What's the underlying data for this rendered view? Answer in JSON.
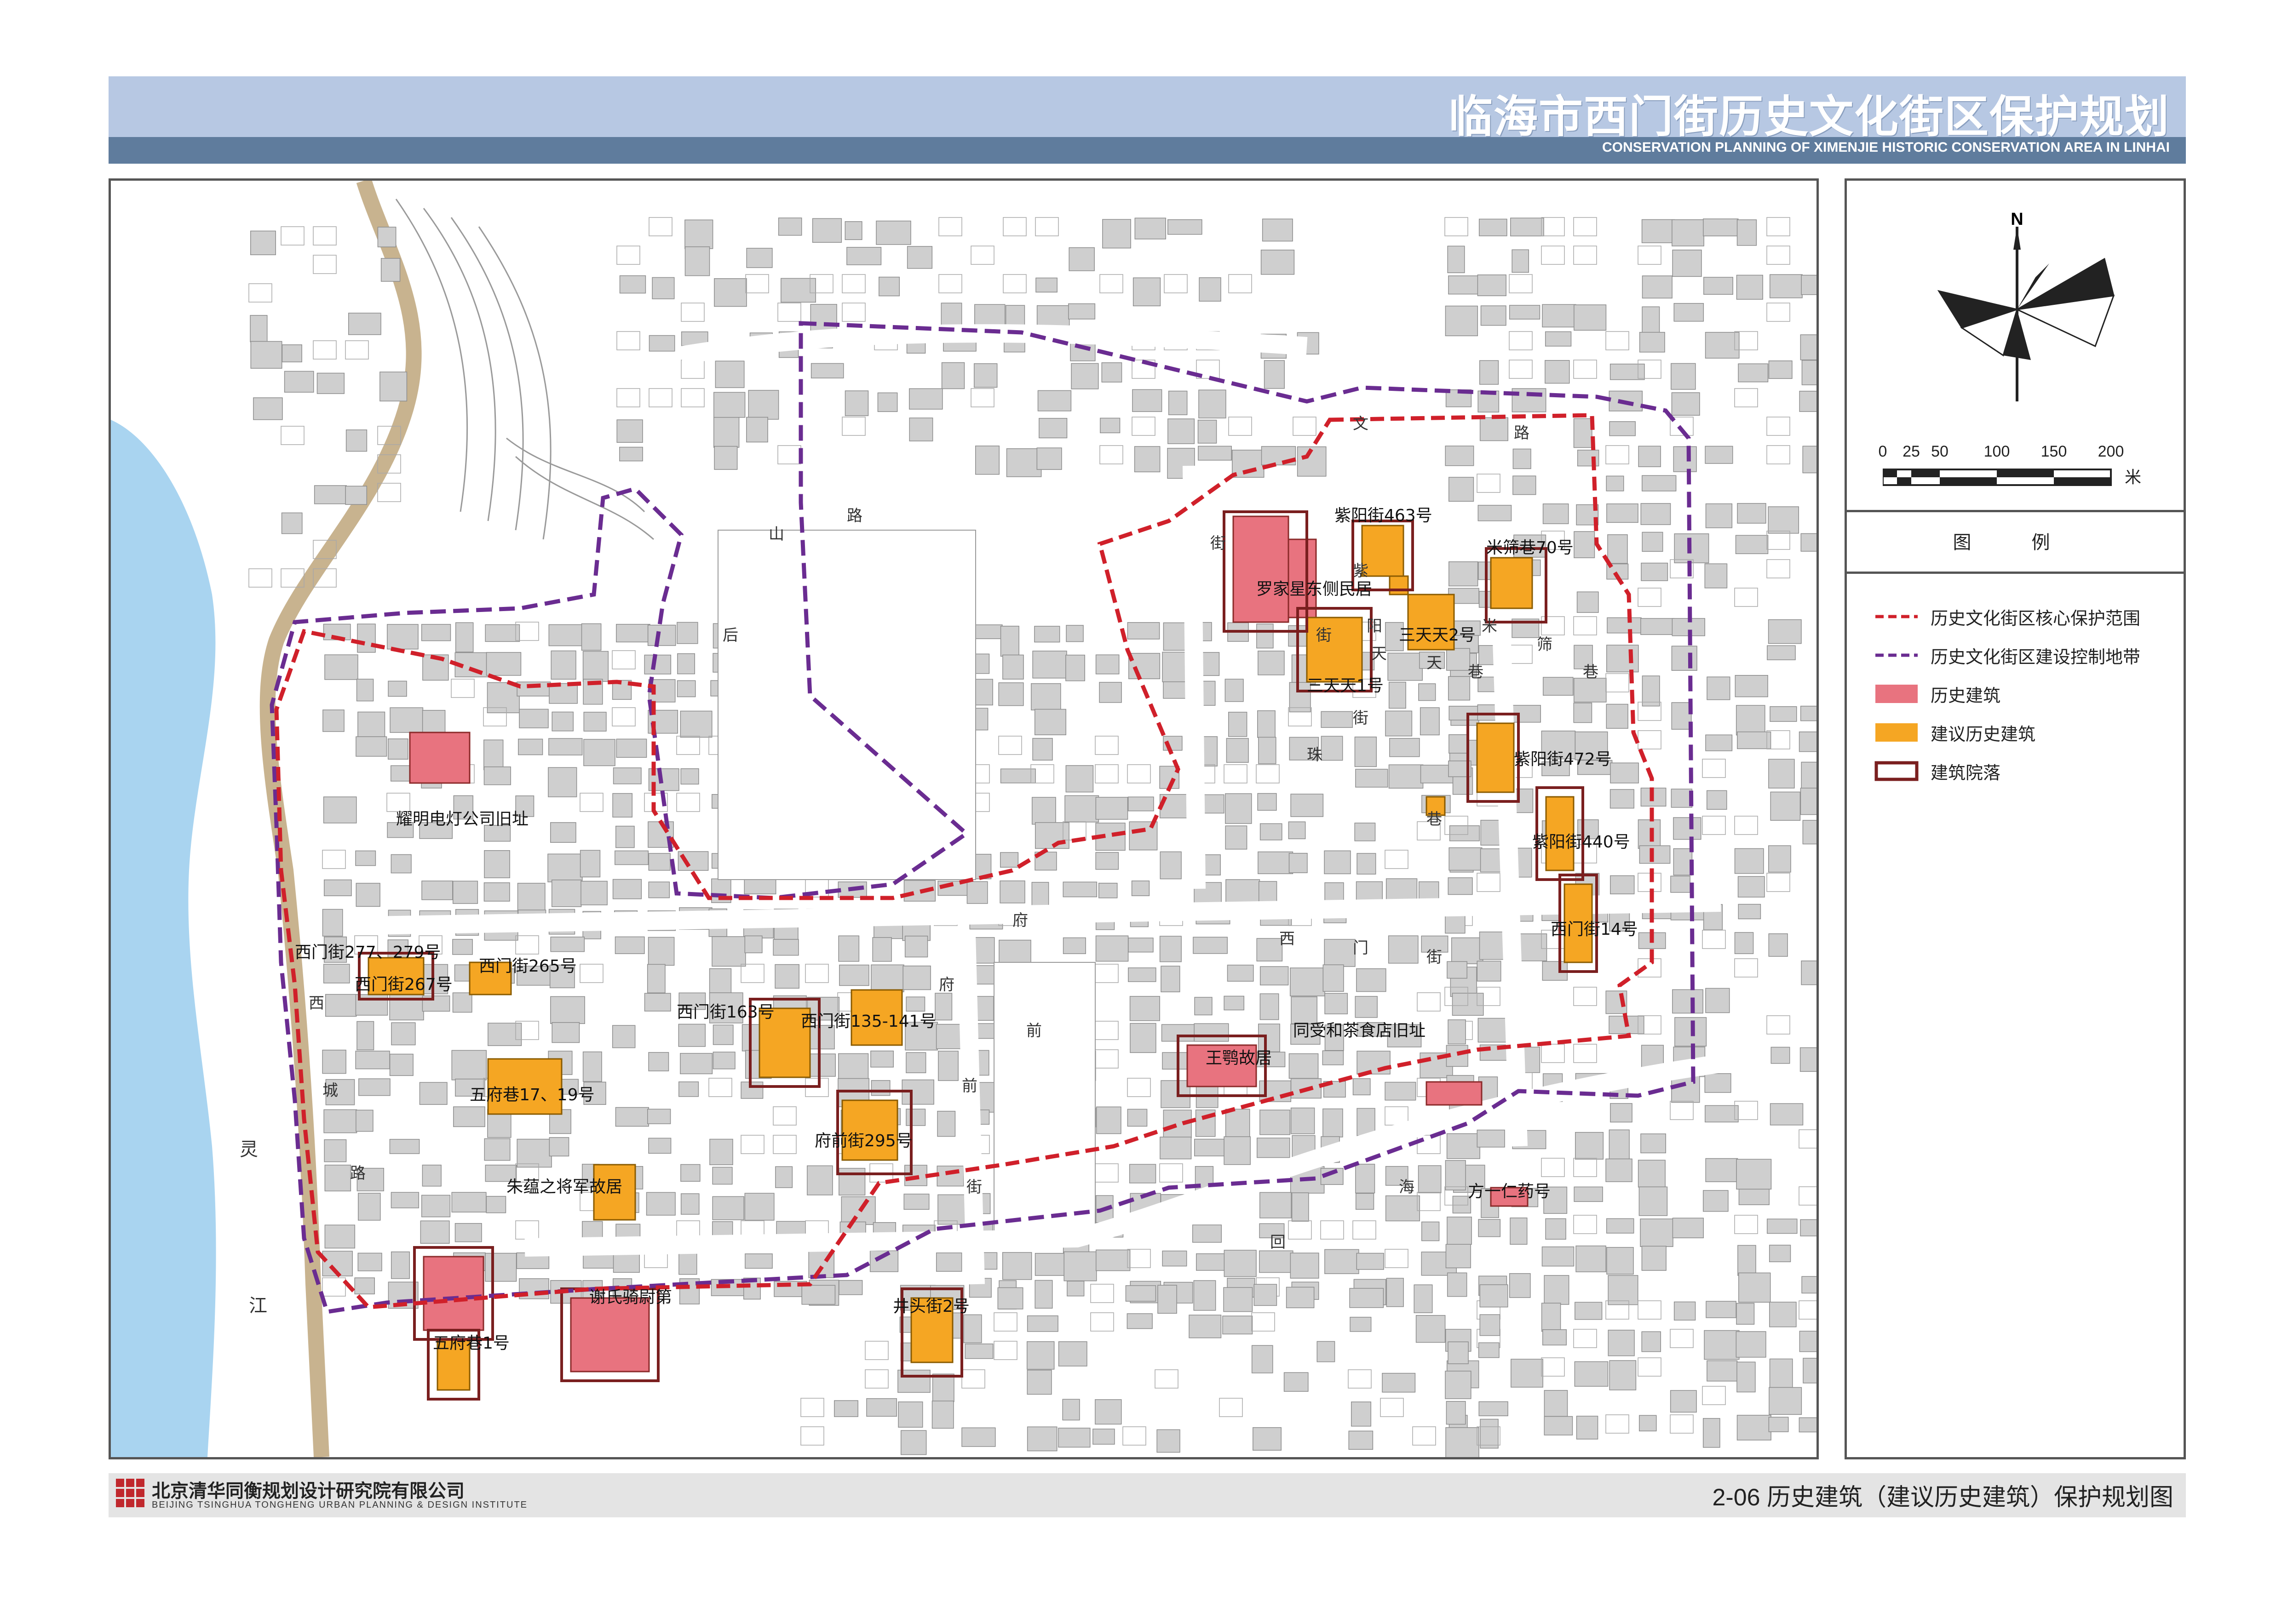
{
  "header": {
    "title_cn": "临海市西门街历史文化街区保护规划",
    "title_en": "CONSERVATION PLANNING OF XIMENJIE HISTORIC CONSERVATION AREA IN LINHAI"
  },
  "colors": {
    "header_band": "#b7c8e3",
    "header_rule": "#5f7c9d",
    "historic_building": "#e8737f",
    "proposed_historic_building": "#f5a623",
    "core_boundary": "#d0202a",
    "control_boundary": "#6a2c91",
    "courtyard": "#7a1f1f",
    "river": "#a9d4f0",
    "city_wall": "#c8b38f",
    "building_gray": "#cfcfcf"
  },
  "compass": {
    "north_label": "N"
  },
  "scale_bar": {
    "ticks": [
      "0",
      "25",
      "50",
      "100",
      "150",
      "200"
    ],
    "unit": "米"
  },
  "legend": {
    "title": "图 例",
    "items": [
      {
        "label": "历史文化街区核心保护范围",
        "swatch": "core-boundary"
      },
      {
        "label": "历史文化街区建设控制地带",
        "swatch": "control-boundary"
      },
      {
        "label": "历史建筑",
        "swatch": "historic-building"
      },
      {
        "label": "建议历史建筑",
        "swatch": "proposed-historic-building"
      },
      {
        "label": "建筑院落",
        "swatch": "courtyard"
      }
    ]
  },
  "map": {
    "labels": [
      "紫阳街463号",
      "罗家星东侧民居",
      "米筛巷70号",
      "三天天2号",
      "三天天1号",
      "紫阳街472号",
      "紫阳街440号",
      "西门街14号",
      "耀明电灯公司旧址",
      "西门街277、279号",
      "西门街265号",
      "西门街267号",
      "西门街163号",
      "西门街135-141号",
      "王鹗故居",
      "同受和茶食店旧址",
      "五府巷17、19号",
      "府前街295号",
      "方一仁药号",
      "朱蕴之将军故居",
      "谢氏骑尉第",
      "井头街2号",
      "五府巷1号"
    ],
    "road_chars": [
      "文",
      "路",
      "路",
      "山",
      "后",
      "街",
      "街",
      "街",
      "府",
      "前",
      "街",
      "西",
      "城",
      "路",
      "回",
      "海",
      "紫",
      "阳",
      "珠",
      "巷",
      "米",
      "筛",
      "巷",
      "天",
      "天",
      "巷",
      "西",
      "门",
      "街",
      "府",
      "前",
      "灵",
      "江"
    ]
  },
  "footer": {
    "org_cn": "北京清华同衡规划设计研究院有限公司",
    "org_en": "BEIJING TSINGHUA TONGHENG URBAN PLANNING & DESIGN INSTITUTE",
    "drawing_title": "2-06 历史建筑（建议历史建筑）保护规划图"
  }
}
